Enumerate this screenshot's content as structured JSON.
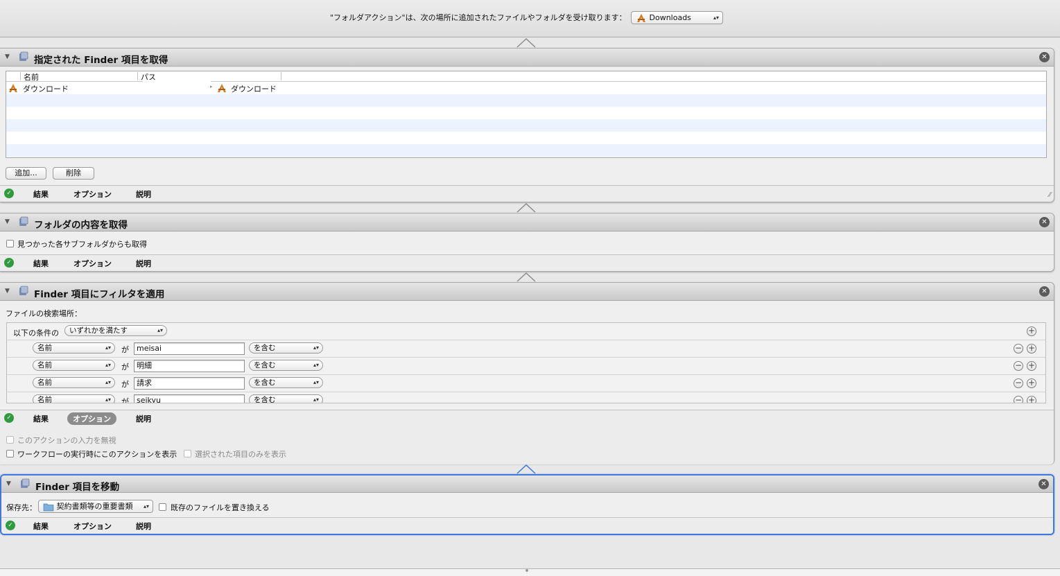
{
  "folder_action": {
    "label": "\"フォルダアクション\"は、次の場所に追加されたファイルやフォルダを受け取ります：",
    "folder": "Downloads"
  },
  "footer_tabs": {
    "results": "結果",
    "options": "オプション",
    "description": "説明"
  },
  "action1": {
    "title": "指定された Finder 項目を取得",
    "col_name": "名前",
    "col_path": "パス",
    "rows": [
      {
        "name": "ダウンロード",
        "path": "ダウンロード"
      }
    ],
    "add_button": "追加...",
    "delete_button": "削除"
  },
  "action2": {
    "title": "フォルダの内容を取得",
    "subfolder_checkbox": "見つかった各サブフォルダからも取得"
  },
  "action3": {
    "title": "Finder 項目にフィルタを適用",
    "search_location": "ファイルの検索場所：",
    "condition_prefix": "以下の条件の",
    "condition_mode": "いずれかを満たす",
    "criteria": [
      {
        "field": "名前",
        "ga": "が",
        "value": "meisai",
        "op": "を含む"
      },
      {
        "field": "名前",
        "ga": "が",
        "value": "明細",
        "op": "を含む"
      },
      {
        "field": "名前",
        "ga": "が",
        "value": "請求",
        "op": "を含む"
      },
      {
        "field": "名前",
        "ga": "が",
        "value": "seikyu",
        "op": "を含む"
      }
    ],
    "option_ignore_input": "このアクションの入力を無視",
    "option_show_when_run": "ワークフローの実行時にこのアクションを表示",
    "option_show_selected_only": "選択された項目のみを表示"
  },
  "action4": {
    "title": "Finder 項目を移動",
    "dest_label": "保存先：",
    "dest_folder": "契約書類等の重要書類",
    "replace_checkbox": "既存のファイルを置き換える"
  },
  "colors": {
    "selected_border": "#3f78d8",
    "check_green": "#2f9b3c",
    "row_alt": "#edf3fe"
  }
}
